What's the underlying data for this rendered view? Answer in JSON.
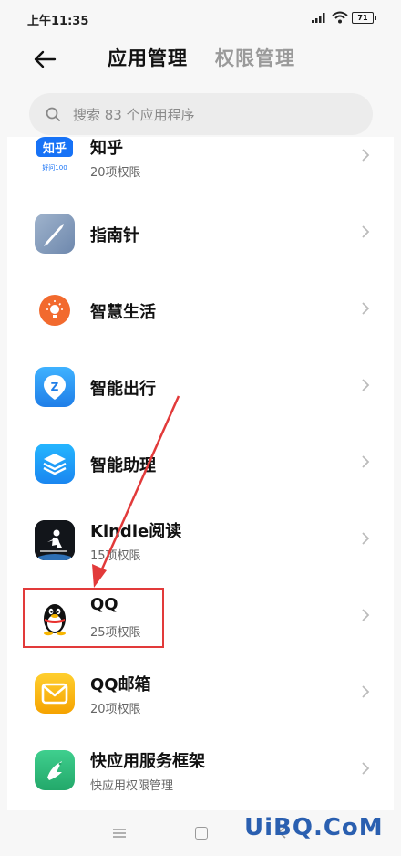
{
  "status": {
    "time": "上午11:35",
    "battery": "71"
  },
  "header": {
    "tab_active": "应用管理",
    "tab_inactive": "权限管理"
  },
  "search": {
    "placeholder": "搜索 83 个应用程序"
  },
  "apps": [
    {
      "name": "知乎",
      "sub": "20项权限",
      "icon": "zhihu-icon",
      "icon_text": "知乎",
      "icon_color": "#1772f6"
    },
    {
      "name": "指南针",
      "sub": "",
      "icon": "compass-icon",
      "icon_color": "#8fa6c3"
    },
    {
      "name": "智慧生活",
      "sub": "",
      "icon": "smart-life-icon",
      "icon_color": "#f26a2e"
    },
    {
      "name": "智能出行",
      "sub": "",
      "icon": "smart-travel-icon",
      "icon_color": "#2e9bf0"
    },
    {
      "name": "智能助理",
      "sub": "",
      "icon": "smart-assistant-icon",
      "icon_color": "#1e9bf0"
    },
    {
      "name": "Kindle阅读",
      "sub": "15项权限",
      "icon": "kindle-icon",
      "icon_color": "#111111"
    },
    {
      "name": "QQ",
      "sub": "25项权限",
      "icon": "qq-penguin-icon",
      "icon_color": "#ffffff"
    },
    {
      "name": "QQ邮箱",
      "sub": "20项权限",
      "icon": "qq-mail-icon",
      "icon_color": "#f7b500"
    },
    {
      "name": "快应用服务框架",
      "sub": "快应用权限管理",
      "icon": "quick-app-icon",
      "icon_color": "#2fb87a"
    }
  ],
  "watermark": "UiBQ.CoM",
  "colors": {
    "highlight": "#e23a3a",
    "watermark": "#2a5fb0"
  }
}
